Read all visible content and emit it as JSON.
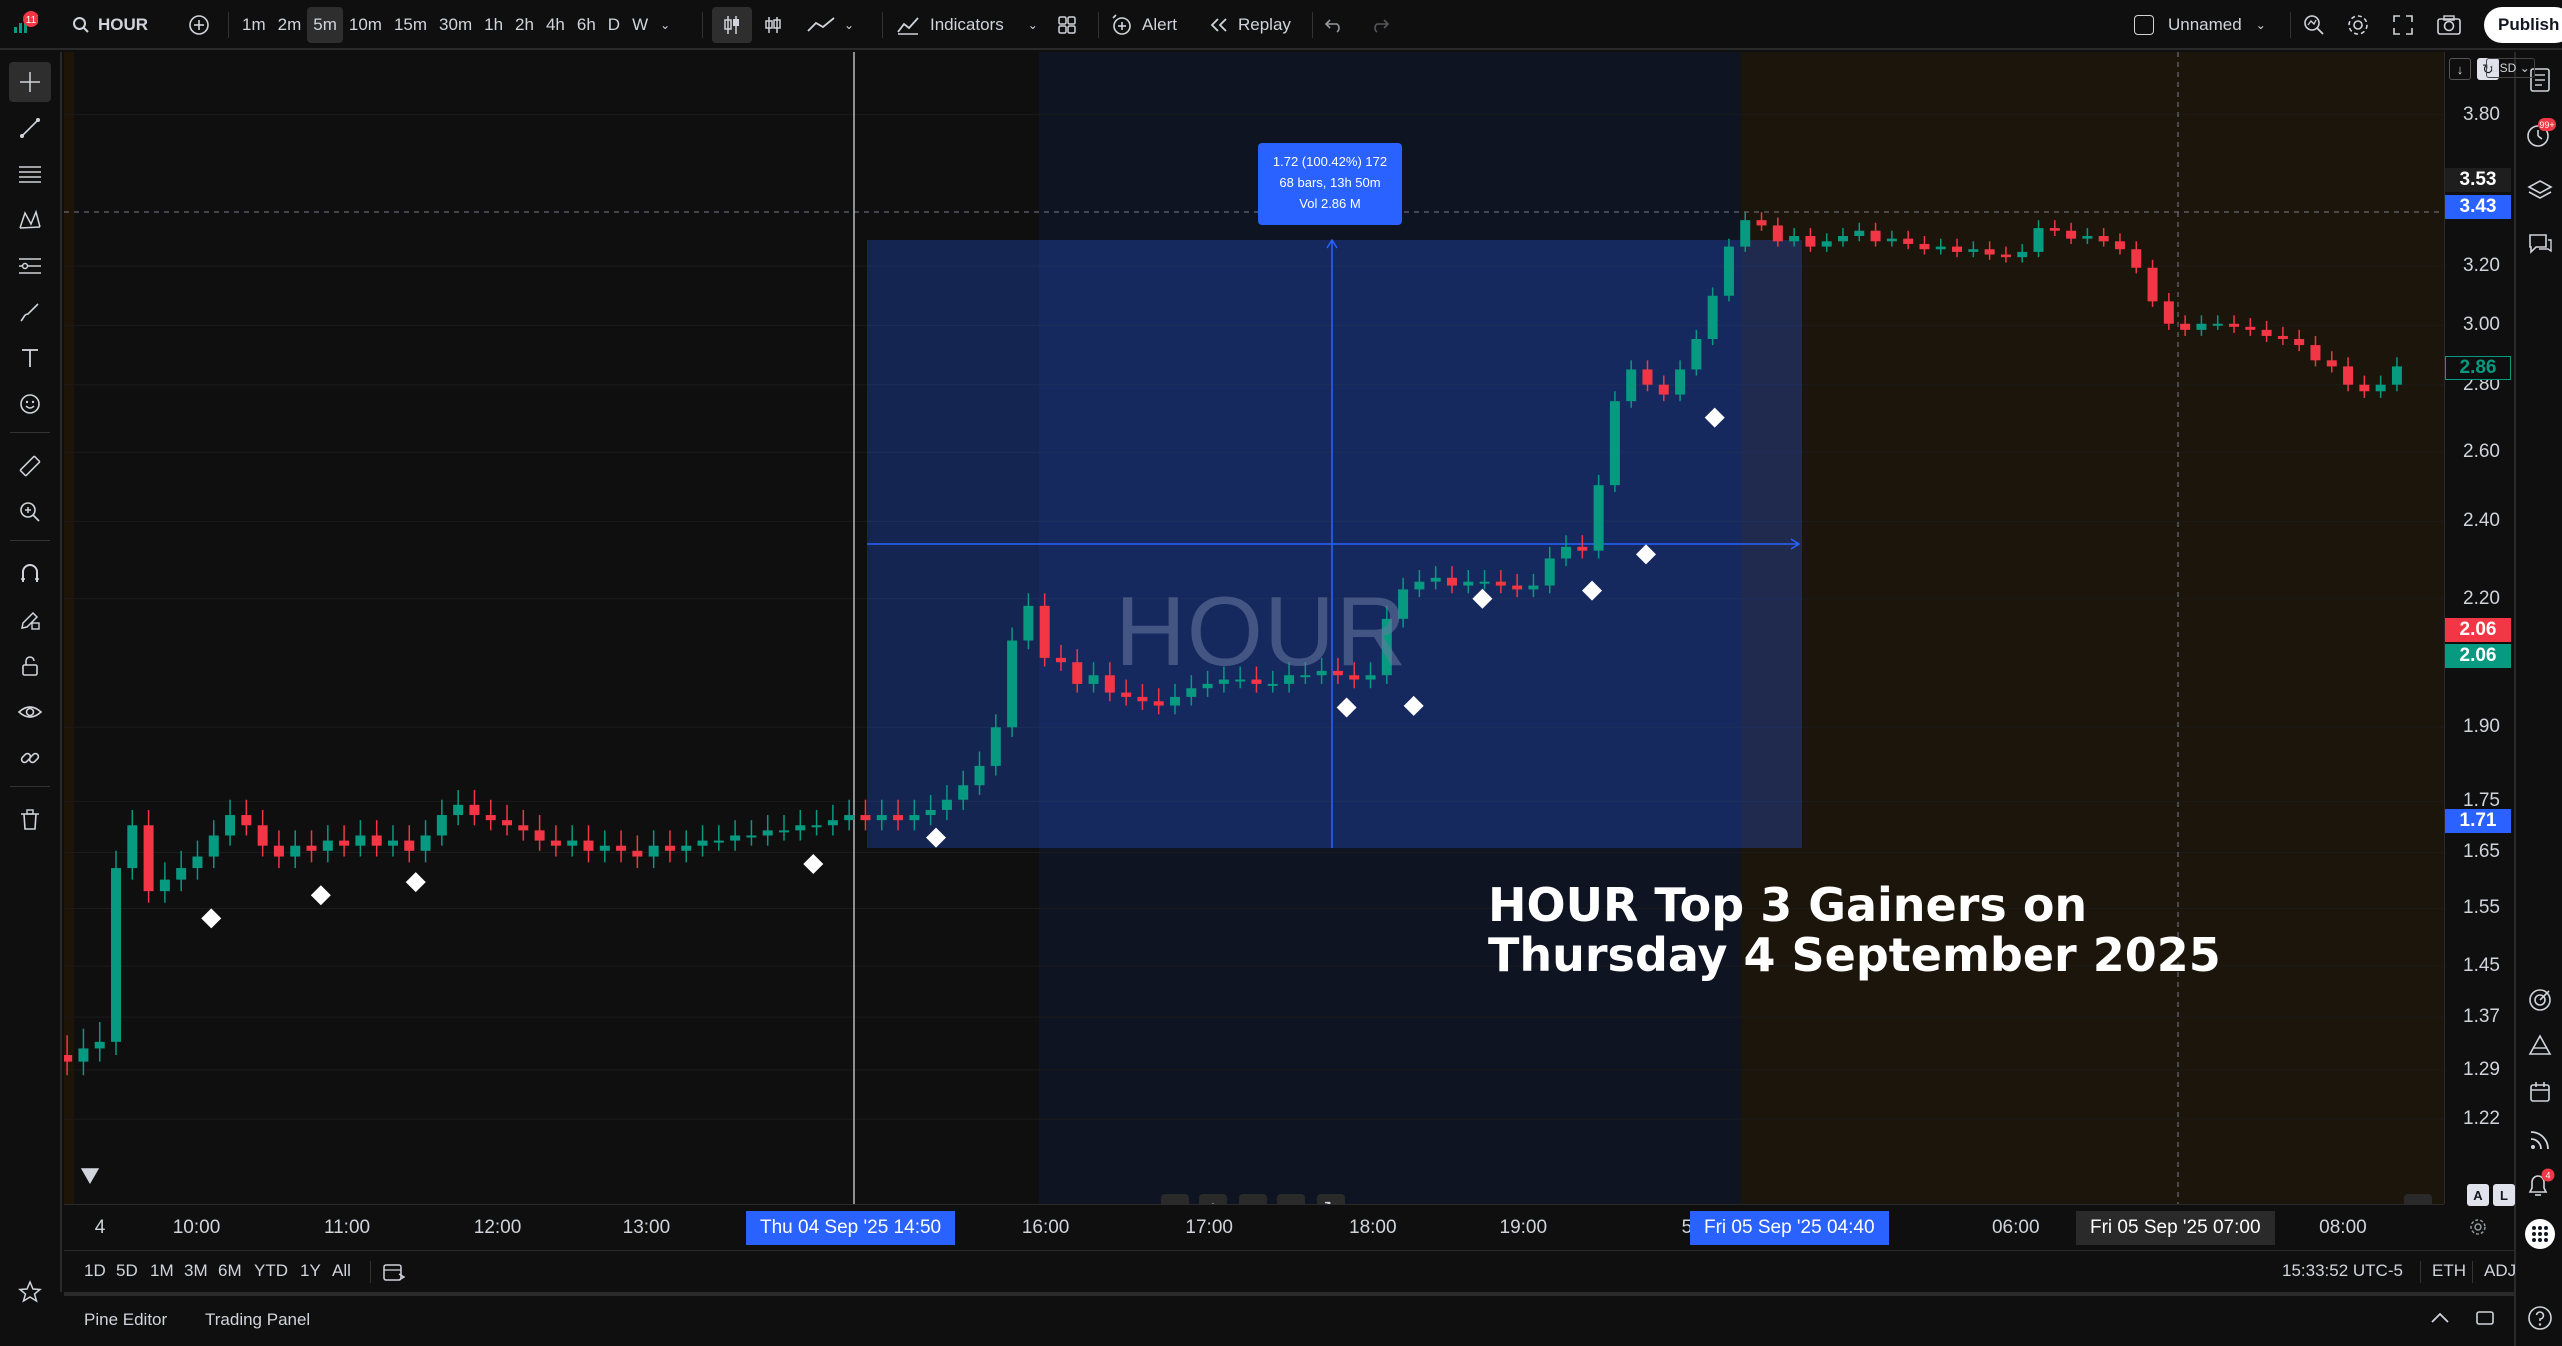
{
  "topbar": {
    "notification_count": "11",
    "symbol": "HOUR",
    "intervals": [
      "1m",
      "2m",
      "5m",
      "10m",
      "15m",
      "30m",
      "1h",
      "2h",
      "4h",
      "6h",
      "D",
      "W"
    ],
    "active_interval": "5m",
    "indicators_label": "Indicators",
    "alert_label": "Alert",
    "replay_label": "Replay",
    "layout_name": "Unnamed",
    "publish_label": "Publish"
  },
  "right_toolbar": {
    "notif_badge": "99+",
    "alerts_badge": "4"
  },
  "chart": {
    "currency": "USD",
    "watermark": "HOUR",
    "overlay_title_line1": "HOUR Top 3 Gainers on",
    "overlay_title_line2": "Thursday 4 September 2025",
    "measure": {
      "line1": "1.72 (100.42%) 172",
      "line2": "68 bars, 13h 50m",
      "line3": "Vol 2.86 M"
    },
    "price_ticks": [
      "3.80",
      "3.20",
      "3.00",
      "2.80",
      "2.60",
      "2.40",
      "2.20",
      "1.90",
      "1.75",
      "1.65",
      "1.55",
      "1.45",
      "1.37",
      "1.29",
      "1.22"
    ],
    "price_labels": [
      {
        "text": "3.53",
        "color": "#1e1e1e"
      },
      {
        "text": "3.43",
        "color": "#2962ff"
      },
      {
        "text": "2.86",
        "color": "#0f0f0f"
      },
      {
        "text": "2.06",
        "color": "#f23645"
      },
      {
        "text": "2.06",
        "color": "#089981"
      },
      {
        "text": "1.71",
        "color": "#2962ff"
      }
    ],
    "time_ticks": [
      "4",
      "10:00",
      "11:00",
      "12:00",
      "13:00",
      "16:00",
      "17:00",
      "18:00",
      "19:00",
      "5",
      "06:00",
      "08:00"
    ],
    "time_labels": [
      {
        "date": "Thu 04 Sep '25",
        "time": "14:50",
        "color": "#2962ff"
      },
      {
        "date": "Fri 05 Sep '25",
        "time": "04:40",
        "color": "#2962ff"
      },
      {
        "date": "Fri 05 Sep '25",
        "time": "07:00",
        "color": "#2a2a2a"
      }
    ],
    "scale_buttons": {
      "auto": "A",
      "log": "L"
    }
  },
  "range_bar": {
    "ranges": [
      "1D",
      "5D",
      "1M",
      "3M",
      "6M",
      "YTD",
      "1Y",
      "All"
    ],
    "clock": "15:33:52 UTC-5",
    "session": "ETH",
    "adj": "ADJ"
  },
  "bottom_panel": {
    "pine_editor": "Pine Editor",
    "trading_panel": "Trading Panel"
  },
  "colors": {
    "up": "#089981",
    "down": "#f23645",
    "accent": "#2962ff",
    "marker": "#ffffff"
  }
}
